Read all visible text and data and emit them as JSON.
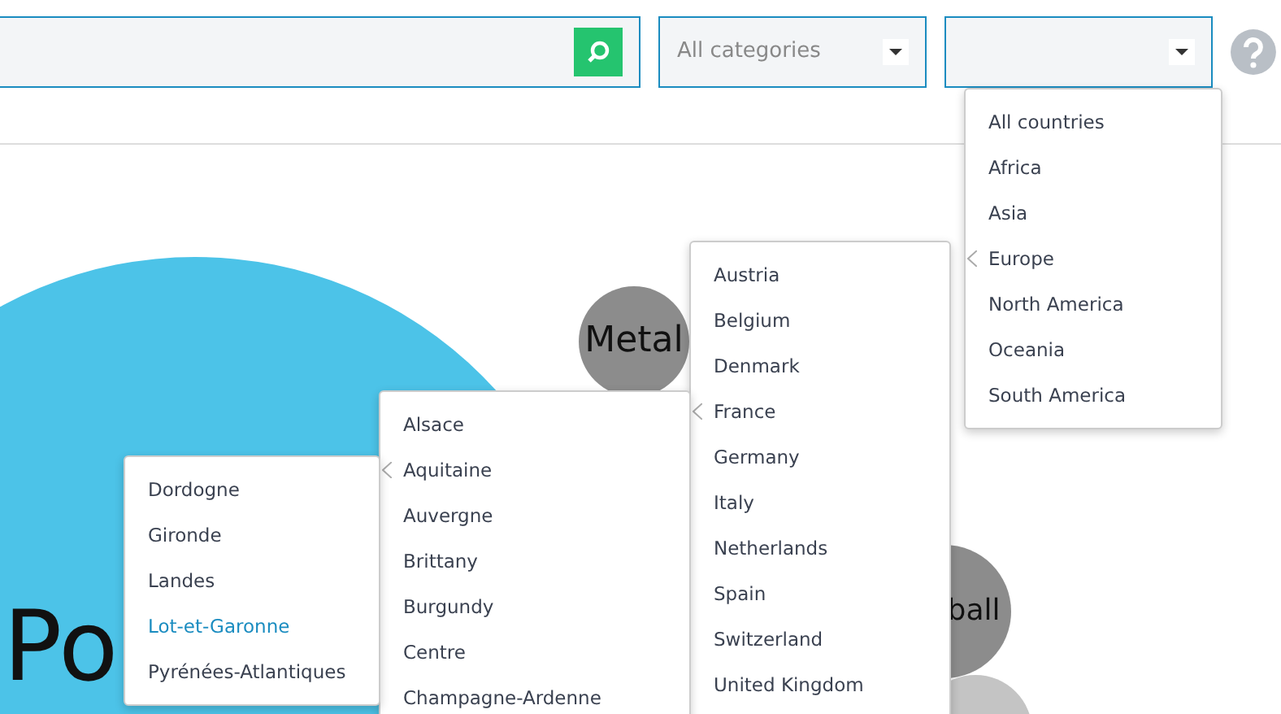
{
  "toolbar": {
    "category_select": {
      "value": "All categories"
    }
  },
  "bubbles": [
    {
      "label": "Po",
      "color": "#4cc3e8"
    },
    {
      "label": "Metal",
      "color": "#8c8c8c"
    },
    {
      "label": "ball",
      "color": "#8c8c8c"
    },
    {
      "color": "#c4c4c4"
    }
  ],
  "menus": [
    {
      "items": [
        {
          "label": "All countries",
          "expanded": false,
          "selected": false
        },
        {
          "label": "Africa",
          "expanded": false,
          "selected": false
        },
        {
          "label": "Asia",
          "expanded": false,
          "selected": false
        },
        {
          "label": "Europe",
          "expanded": true,
          "selected": false
        },
        {
          "label": "North America",
          "expanded": false,
          "selected": false
        },
        {
          "label": "Oceania",
          "expanded": false,
          "selected": false
        },
        {
          "label": "South America",
          "expanded": false,
          "selected": false
        }
      ]
    },
    {
      "items": [
        {
          "label": "Austria",
          "expanded": false,
          "selected": false
        },
        {
          "label": "Belgium",
          "expanded": false,
          "selected": false
        },
        {
          "label": "Denmark",
          "expanded": false,
          "selected": false
        },
        {
          "label": "France",
          "expanded": true,
          "selected": false
        },
        {
          "label": "Germany",
          "expanded": false,
          "selected": false
        },
        {
          "label": "Italy",
          "expanded": false,
          "selected": false
        },
        {
          "label": "Netherlands",
          "expanded": false,
          "selected": false
        },
        {
          "label": "Spain",
          "expanded": false,
          "selected": false
        },
        {
          "label": "Switzerland",
          "expanded": false,
          "selected": false
        },
        {
          "label": "United Kingdom",
          "expanded": false,
          "selected": false
        }
      ]
    },
    {
      "items": [
        {
          "label": "Alsace",
          "expanded": false,
          "selected": false
        },
        {
          "label": "Aquitaine",
          "expanded": true,
          "selected": false
        },
        {
          "label": "Auvergne",
          "expanded": false,
          "selected": false
        },
        {
          "label": "Brittany",
          "expanded": false,
          "selected": false
        },
        {
          "label": "Burgundy",
          "expanded": false,
          "selected": false
        },
        {
          "label": "Centre",
          "expanded": false,
          "selected": false
        },
        {
          "label": "Champagne-Ardenne",
          "expanded": false,
          "selected": false
        }
      ]
    },
    {
      "items": [
        {
          "label": "Dordogne",
          "expanded": false,
          "selected": false
        },
        {
          "label": "Gironde",
          "expanded": false,
          "selected": false
        },
        {
          "label": "Landes",
          "expanded": false,
          "selected": false
        },
        {
          "label": "Lot-et-Garonne",
          "expanded": false,
          "selected": true
        },
        {
          "label": "Pyrénées-Atlantiques",
          "expanded": false,
          "selected": false
        }
      ]
    }
  ]
}
